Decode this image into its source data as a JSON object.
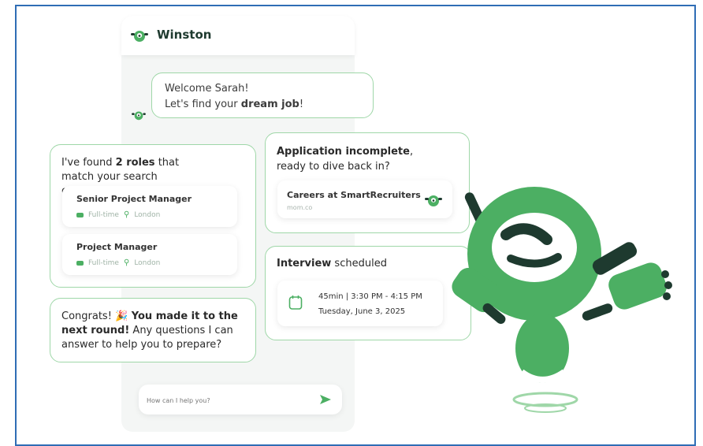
{
  "chat": {
    "bot_name": "Winston",
    "welcome_line1": "Welcome Sarah!",
    "welcome_line2_prefix": "Let's find your ",
    "welcome_line2_bold": "dream job",
    "welcome_line2_suffix": "!"
  },
  "roles_card": {
    "text_prefix": "I've found ",
    "text_bold": "2 roles",
    "text_suffix": " that match your search criteria",
    "roles": [
      {
        "title": "Senior Project Manager",
        "type": "Full-time",
        "location": "London"
      },
      {
        "title": "Project Manager",
        "type": "Full-time",
        "location": "London"
      }
    ]
  },
  "congrats_card": {
    "prefix": "Congrats! ",
    "emoji": "🎉",
    "bold": " You made it to the next round!",
    "suffix": " Any questions I can answer to help you to prepare?"
  },
  "application_card": {
    "title_bold": "Application incomplete",
    "title_rest": ",",
    "subtitle": "ready to dive back in?",
    "career_title": "Careers at SmartRecruiters",
    "career_sub": "mom.co"
  },
  "interview_card": {
    "title_bold": "Interview",
    "title_rest": " scheduled",
    "time": "45min | 3:30 PM - 4:15 PM",
    "date": "Tuesday, June 3, 2025"
  },
  "input": {
    "placeholder": "How can I help you?"
  },
  "colors": {
    "accent_green": "#4caf63",
    "card_border": "#9fd7a8",
    "frame_border": "#2f6db5"
  }
}
